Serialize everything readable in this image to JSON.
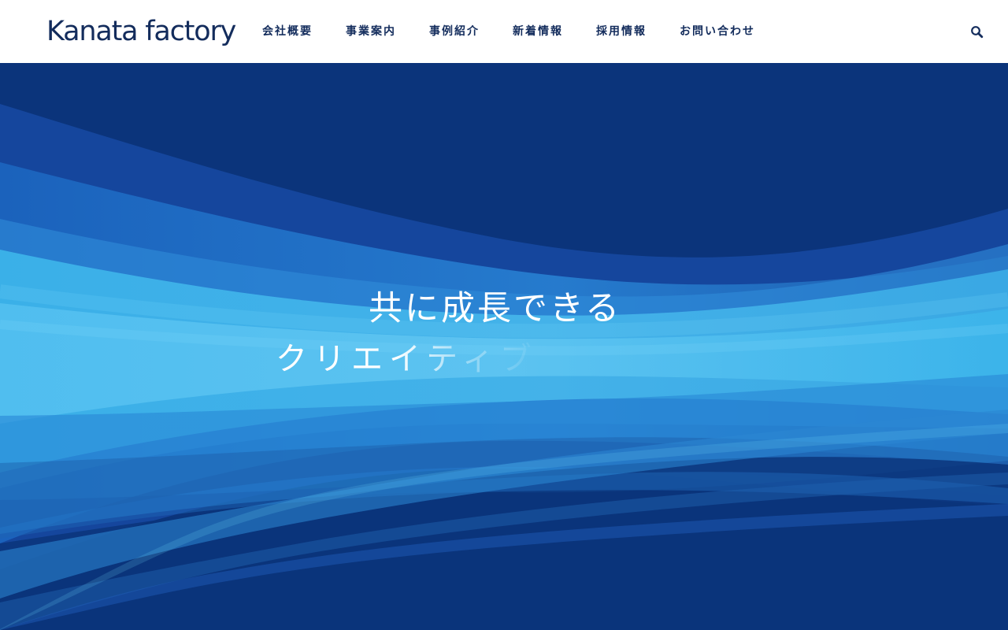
{
  "header": {
    "logo_text": "Kanata factory",
    "nav": [
      {
        "label": "会社概要",
        "name": "nav-company-overview"
      },
      {
        "label": "事業案内",
        "name": "nav-business-guide"
      },
      {
        "label": "事例紹介",
        "name": "nav-case-studies"
      },
      {
        "label": "新着情報",
        "name": "nav-news"
      },
      {
        "label": "採用情報",
        "name": "nav-recruitment"
      },
      {
        "label": "お問い合わせ",
        "name": "nav-contact"
      }
    ],
    "search_icon": "search-icon"
  },
  "hero": {
    "catch_line_1": "共に成長できる",
    "catch_line_2": "クリエイティブ"
  },
  "colors": {
    "header_background": "#ffffff",
    "brand_navy": "#132c5c",
    "hero_deep_blue": "#0b347b",
    "wave_sky_blue": "#3db3eb",
    "text_on_hero": "#ffffff"
  }
}
